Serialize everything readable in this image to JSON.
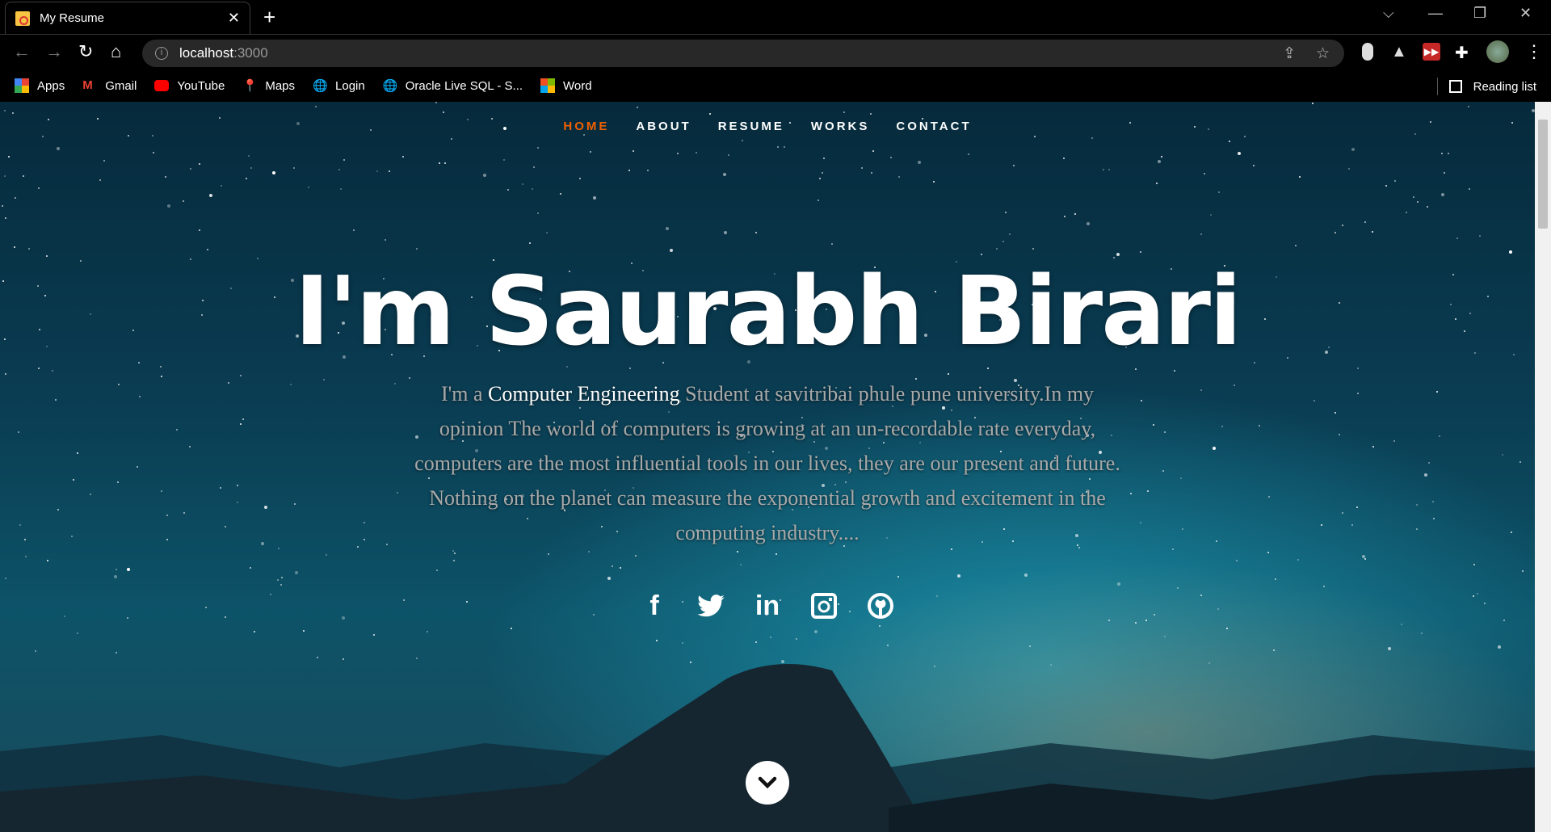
{
  "browser": {
    "tab_title": "My Resume",
    "url_host": "localhost",
    "url_port": ":3000",
    "bookmarks": [
      "Apps",
      "Gmail",
      "YouTube",
      "Maps",
      "Login",
      "Oracle Live SQL - S...",
      "Word"
    ],
    "reading_list": "Reading list"
  },
  "nav": {
    "items": [
      "HOME",
      "ABOUT",
      "RESUME",
      "WORKS",
      "CONTACT"
    ],
    "active": "HOME",
    "accent": "#f06000"
  },
  "hero": {
    "title": "I'm Saurabh Birari",
    "bio_prefix": "I'm a ",
    "bio_highlight": "Computer Engineering",
    "bio_rest": " Student at savitribai phule pune university.In my opinion The world of computers is growing at an un-recordable rate everyday, computers are the most influential tools in our lives, they are our present and future. Nothing on the planet can measure the exponential growth and excitement in the computing industry...."
  },
  "social": [
    "facebook-icon",
    "twitter-icon",
    "linkedin-icon",
    "instagram-icon",
    "github-icon"
  ]
}
